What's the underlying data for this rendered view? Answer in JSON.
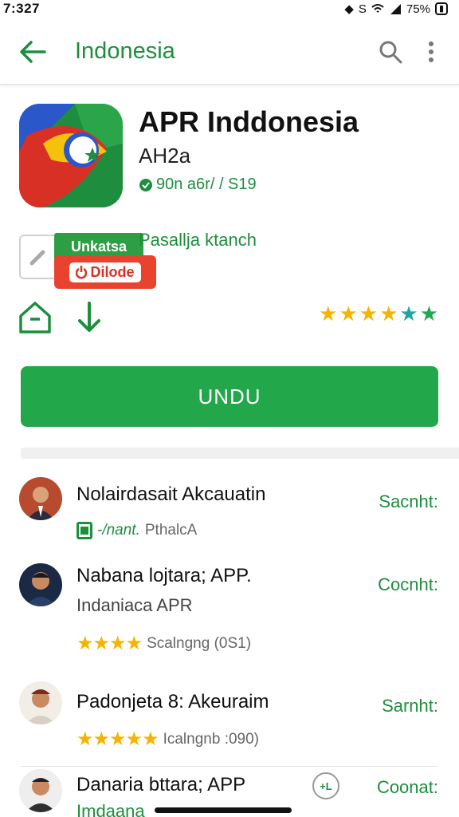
{
  "status_bar": {
    "time": "7:327",
    "battery": "75%"
  },
  "app_bar": {
    "title": "Indonesia"
  },
  "app": {
    "name": "APR Inddonesia",
    "developer": "AH2a",
    "meta": "90n a6r/ / S19"
  },
  "promo": {
    "badge_top": "Unkatsa",
    "badge_bottom": "Dilode",
    "caption": "Pasallja ktanch"
  },
  "rating": {
    "stars": 6
  },
  "install_button": {
    "label": "UNDU"
  },
  "list": [
    {
      "title": "Nolairdasait Akcauatin",
      "action": "Sacnht:",
      "tag_text": "-/nant.",
      "meta": "PthalcA"
    },
    {
      "title": "Nabana lojtara; APP.",
      "subtitle": "Indaniaca APR",
      "action": "Cocnht:",
      "meta": "Scalngng (0S1)",
      "stars": 4
    },
    {
      "title": "Padonjeta 8: Akeuraim",
      "action": "Sarnht:",
      "meta": "Icalngnb :090)",
      "stars": 5
    },
    {
      "title": "Danaria bttara; APP",
      "subtitle": "Imdaana",
      "action": "Coonat:",
      "round_btn": "+L"
    }
  ],
  "colors": {
    "accent": "#1e8e3e",
    "install": "#23a74b",
    "star": "#f5b400",
    "star_alt": "#1ea7a0"
  }
}
